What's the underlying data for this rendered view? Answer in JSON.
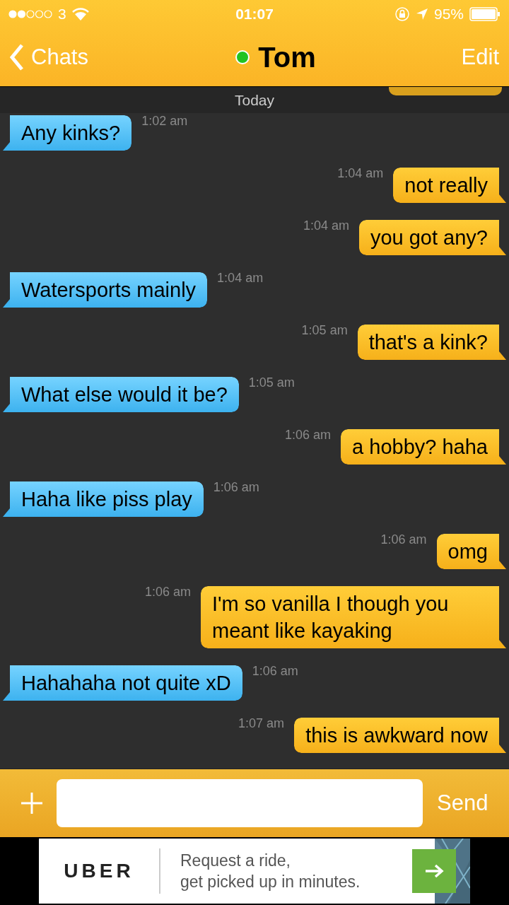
{
  "status_bar": {
    "carrier": "3",
    "time": "01:07",
    "battery": "95%"
  },
  "nav": {
    "back": "Chats",
    "title": "Tom",
    "online": true,
    "action": "Edit"
  },
  "date_divider": "Today",
  "messages": [
    {
      "kind": "incoming",
      "text": "Any kinks?",
      "time": "1:02 am"
    },
    {
      "kind": "outgoing",
      "text": "not really",
      "time": "1:04 am"
    },
    {
      "kind": "outgoing",
      "text": "you got any?",
      "time": "1:04 am"
    },
    {
      "kind": "incoming",
      "text": "Watersports mainly",
      "time": "1:04 am"
    },
    {
      "kind": "outgoing",
      "text": "that's a kink?",
      "time": "1:05 am"
    },
    {
      "kind": "incoming",
      "text": "What else would it be?",
      "time": "1:05 am"
    },
    {
      "kind": "outgoing",
      "text": "a hobby? haha",
      "time": "1:06 am"
    },
    {
      "kind": "incoming",
      "text": "Haha like piss play",
      "time": "1:06 am"
    },
    {
      "kind": "outgoing",
      "text": "omg",
      "time": "1:06 am"
    },
    {
      "kind": "outgoing",
      "text": "I'm so vanilla I though you meant like kayaking",
      "time": "1:06 am"
    },
    {
      "kind": "incoming",
      "text": "Hahahaha not quite xD",
      "time": "1:06 am"
    },
    {
      "kind": "outgoing",
      "text": "this is awkward now",
      "time": "1:07 am"
    }
  ],
  "composer": {
    "send": "Send"
  },
  "ad": {
    "brand": "UBER",
    "lines": [
      "Request a ride,",
      "get picked up in minutes."
    ]
  }
}
